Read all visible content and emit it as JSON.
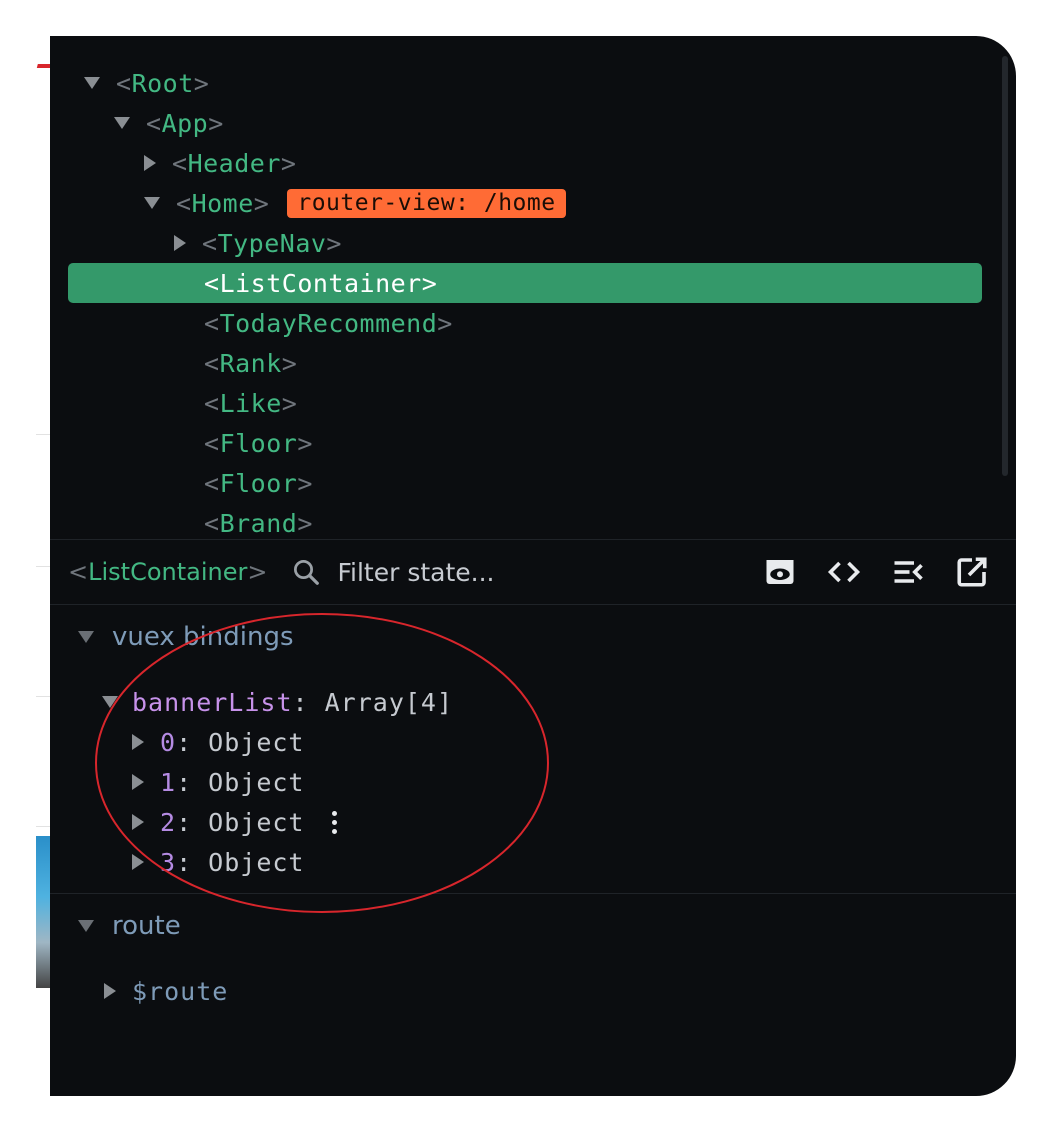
{
  "tree": {
    "nodes": [
      {
        "name": "Root",
        "expand": "down",
        "depth": 0
      },
      {
        "name": "App",
        "expand": "down",
        "depth": 1
      },
      {
        "name": "Header",
        "expand": "right",
        "depth": 2
      },
      {
        "name": "Home",
        "expand": "down",
        "depth": 2,
        "badge": "router-view: /home"
      },
      {
        "name": "TypeNav",
        "expand": "right",
        "depth": 3
      },
      {
        "name": "ListContainer",
        "expand": "none",
        "depth": 3,
        "selected": true
      },
      {
        "name": "TodayRecommend",
        "expand": "none",
        "depth": 3
      },
      {
        "name": "Rank",
        "expand": "none",
        "depth": 3
      },
      {
        "name": "Like",
        "expand": "none",
        "depth": 3
      },
      {
        "name": "Floor",
        "expand": "none",
        "depth": 3
      },
      {
        "name": "Floor",
        "expand": "none",
        "depth": 3
      },
      {
        "name": "Brand",
        "expand": "none",
        "depth": 3
      }
    ]
  },
  "toolbar": {
    "component_name": "ListContainer",
    "filter_placeholder": "Filter state...",
    "icons": [
      "eye-icon",
      "code-icon",
      "collapse-list-icon",
      "open-external-icon"
    ]
  },
  "state": {
    "sections": [
      {
        "title": "vuex bindings",
        "root_key": "bannerList",
        "root_value": "Array[4]",
        "items": [
          {
            "key": "0",
            "value": "Object"
          },
          {
            "key": "1",
            "value": "Object"
          },
          {
            "key": "2",
            "value": "Object"
          },
          {
            "key": "3",
            "value": "Object"
          }
        ]
      },
      {
        "title": "route",
        "root_key": "$route"
      }
    ]
  },
  "colors": {
    "background": "#0b0d10",
    "component_green": "#43b883",
    "selected_row": "#34996a",
    "router_badge": "#ff6b35",
    "annotation_circle": "#d8262c"
  }
}
